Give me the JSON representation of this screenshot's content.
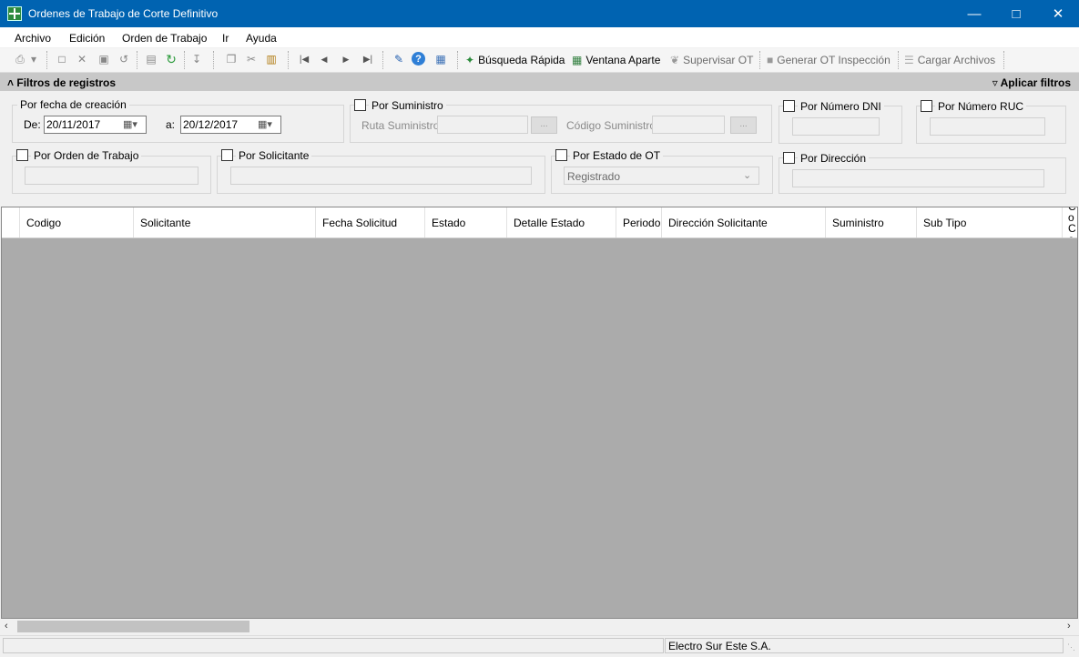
{
  "window": {
    "title": "Ordenes de Trabajo de Corte Definitivo"
  },
  "menu": [
    "Archivo",
    "Edición",
    "Orden de Trabajo",
    "Ir",
    "Ayuda"
  ],
  "toolbar": {
    "quick_search": "Búsqueda Rápida",
    "separate_window": "Ventana Aparte",
    "supervise": "Supervisar OT",
    "generate_inspection": "Generar OT Inspección",
    "load_files": "Cargar Archivos"
  },
  "filters": {
    "title": "Filtros de registros",
    "apply": "Aplicar filtros",
    "creation": {
      "label": "Por fecha de creación",
      "from_label": "De:",
      "from": "20/11/2017",
      "to_label": "a:",
      "to": "20/12/2017"
    },
    "supply": {
      "label": "Por Suministro",
      "route_label": "Ruta Suministro:",
      "code_label": "Código Suministro:",
      "dots": "..."
    },
    "dni": {
      "label": "Por Número DNI"
    },
    "ruc": {
      "label": "Por Número RUC"
    },
    "work_order": {
      "label": "Por Orden de Trabajo"
    },
    "requester": {
      "label": "Por Solicitante"
    },
    "status": {
      "label": "Por Estado de OT",
      "selected": "Registrado"
    },
    "address": {
      "label": "Por Dirección"
    }
  },
  "grid": {
    "columns": [
      "Codigo",
      "Solicitante",
      "Fecha Solicitud",
      "Estado",
      "Detalle Estado",
      "Periodo",
      "Dirección Solicitante",
      "Suministro",
      "Sub Tipo",
      "Co Co"
    ]
  },
  "status_bar": {
    "company": "Electro Sur Este S.A."
  }
}
